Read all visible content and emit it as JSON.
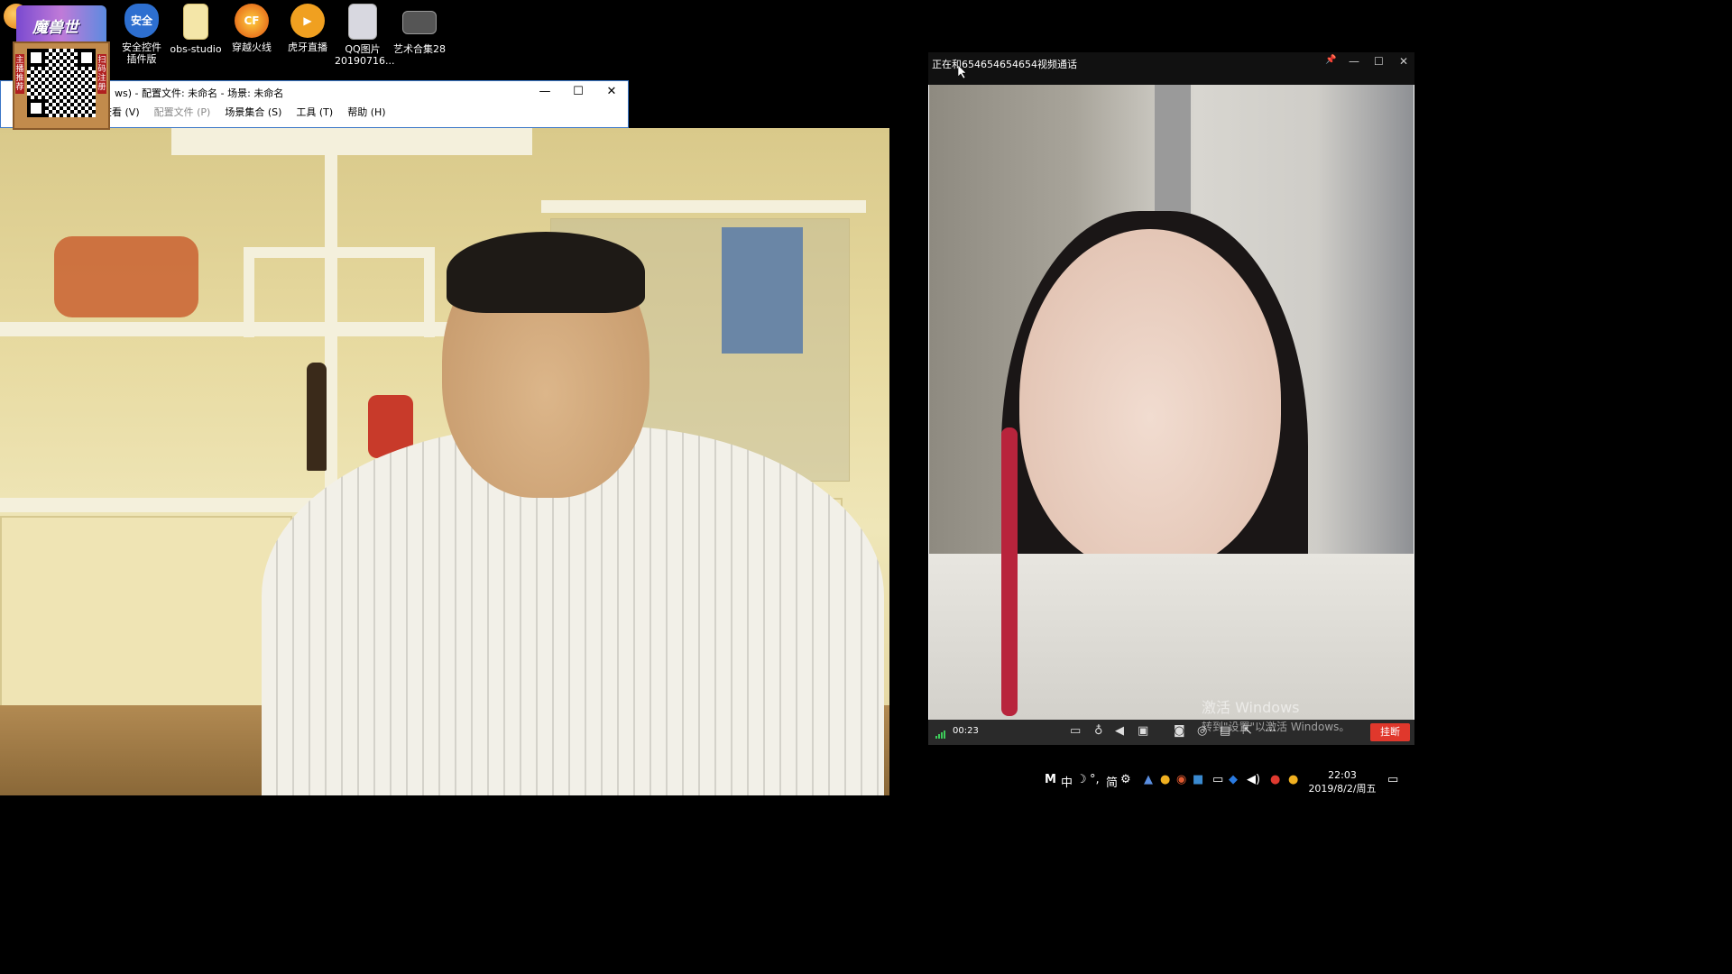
{
  "desktop_icons": [
    {
      "label": "安全控件\n插件版",
      "icon": "shield-icon"
    },
    {
      "label": "obs-studio",
      "icon": "folder-icon"
    },
    {
      "label": "穿越火线",
      "icon": "cf-game-icon"
    },
    {
      "label": "虎牙直播",
      "icon": "huya-icon"
    },
    {
      "label": "QQ图片\n20190716...",
      "icon": "qq-image-icon"
    },
    {
      "label": "艺术合集28",
      "icon": "image-collection-icon"
    }
  ],
  "qr_widget": {
    "header_text": "魔兽世",
    "left_label": "主播推荐",
    "right_label": "扫码注册"
  },
  "obs_window": {
    "title": "ws) - 配置文件: 未命名 - 场景: 未命名",
    "menu": [
      {
        "label": "查看 (V)",
        "enabled": true
      },
      {
        "label": "配置文件 (P)",
        "enabled": false
      },
      {
        "label": "场景集合 (S)",
        "enabled": true
      },
      {
        "label": "工具 (T)",
        "enabled": true
      },
      {
        "label": "帮助 (H)",
        "enabled": true
      }
    ],
    "controls": {
      "minimize": "—",
      "maximize": "☐",
      "close": "✕"
    }
  },
  "call_window": {
    "title": "正在和654654654654视频通话",
    "controls": {
      "pin": "📌",
      "minimize": "—",
      "maximize": "☐",
      "close": "✕"
    },
    "timer": "00:23",
    "hangup_label": "挂断",
    "toolbar_icons": [
      "chat-icon",
      "microphone-icon",
      "speaker-icon",
      "camera-off-icon",
      "screenshot-icon",
      "record-icon",
      "layout-icon",
      "share-icon",
      "more-icon"
    ]
  },
  "watermark": {
    "line1": "激活 Windows",
    "line2": "转到\"设置\"以激活 Windows。"
  },
  "tray": {
    "ime": [
      "M",
      "中",
      "☽",
      "°,",
      "简",
      "⚙"
    ],
    "clock_time": "22:03",
    "clock_date": "2019/8/2/周五"
  }
}
